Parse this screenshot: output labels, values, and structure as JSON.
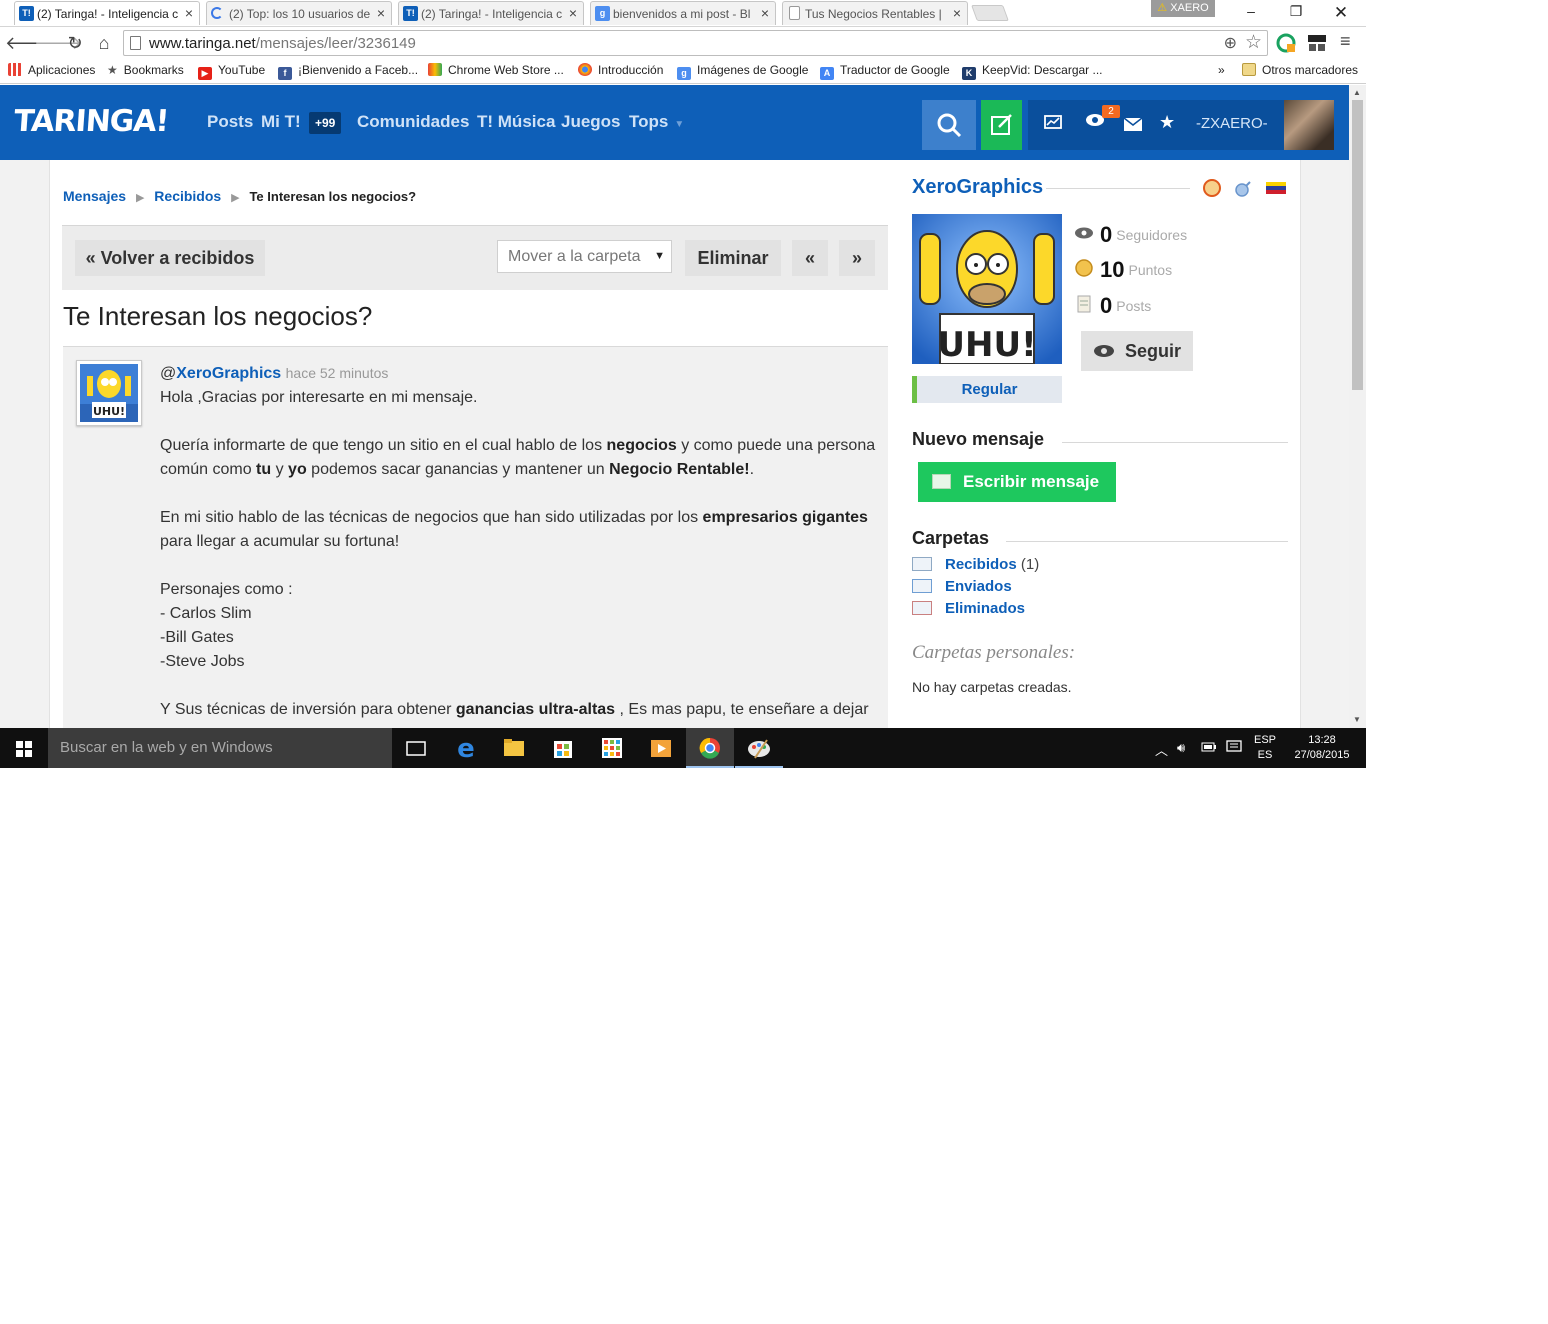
{
  "tabs": [
    {
      "title": "(2) Taringa! - Inteligencia c",
      "favicon": "T!",
      "active": true
    },
    {
      "title": "(2) Top: los 10 usuarios de",
      "favicon": "loading",
      "active": false
    },
    {
      "title": "(2) Taringa! - Inteligencia c",
      "favicon": "T!",
      "active": false
    },
    {
      "title": "bienvenidos a mi post - Bl",
      "favicon": "blogger",
      "active": false
    },
    {
      "title": "Tus Negocios Rentables |",
      "favicon": "page",
      "active": false
    }
  ],
  "chrome_user": "XAERO",
  "address_bar": {
    "url_host": "www.taringa.net",
    "url_path": "/mensajes/leer/3236149"
  },
  "bookmarks": {
    "apps": "Aplicaciones",
    "items": [
      "Bookmarks",
      "YouTube",
      "¡Bienvenido a Faceb...",
      "Chrome Web Store ...",
      "Introducción",
      "Imágenes de Google",
      "Traductor de Google",
      "KeepVid: Descargar ..."
    ],
    "overflow": "»",
    "other": "Otros marcadores"
  },
  "site_header": {
    "logo": "TARINGA!",
    "nav": {
      "posts": "Posts",
      "mi_t": "Mi T!",
      "badge": "+99",
      "comunidades": "Comunidades",
      "musica": "T! Música",
      "juegos": "Juegos",
      "tops": "Tops"
    },
    "notification_count": "2",
    "username": "-ZXAERO-"
  },
  "breadcrumb": {
    "root": "Mensajes",
    "folder": "Recibidos",
    "current": "Te Interesan los negocios?"
  },
  "actions": {
    "back": "« Volver a recibidos",
    "move_placeholder": "Mover a la carpeta",
    "delete": "Eliminar",
    "prev": "«",
    "next": "»"
  },
  "message": {
    "title": "Te Interesan los negocios?",
    "at": "@",
    "author": "XeroGraphics",
    "time": "hace 52 minutos",
    "greeting": "Hola ,Gracias por interesarte en mi mensaje.",
    "p1_a": "Quería informarte de que tengo un sitio en el cual hablo de los ",
    "p1_b": "negocios",
    "p1_c": " y como puede una persona común como ",
    "p1_d": "tu",
    "p1_e": " y ",
    "p1_f": "yo",
    "p1_g": " podemos sacar ganancias y mantener un ",
    "p1_h": "Negocio Rentable!",
    "p1_i": ".",
    "p2_a": "En mi sitio hablo de las técnicas de negocios que han sido utilizadas por los ",
    "p2_b": "empresarios gigantes",
    "p2_c": " para llegar a acumular su fortuna!",
    "p3_intro": "Personajes como :",
    "p3_l1": "- Carlos Slim",
    "p3_l2": "-Bill Gates",
    "p3_l3": "-Steve Jobs",
    "p4_a": "Y Sus técnicas de inversión para obtener ",
    "p4_b": "ganancias ultra-altas",
    "p4_c": " , Es mas papu, te enseñare a dejar"
  },
  "profile": {
    "name": "XeroGraphics",
    "image_caption": "UHU!",
    "followers": "0",
    "followers_label": "Seguidores",
    "points": "10",
    "points_label": "Puntos",
    "posts": "0",
    "posts_label": "Posts",
    "follow": "Seguir",
    "rank": "Regular"
  },
  "new_message": {
    "heading": "Nuevo mensaje",
    "button": "Escribir mensaje"
  },
  "folders": {
    "heading": "Carpetas",
    "items": [
      {
        "name": "Recibidos",
        "count": "(1)"
      },
      {
        "name": "Enviados",
        "count": ""
      },
      {
        "name": "Eliminados",
        "count": ""
      }
    ],
    "personal_heading": "Carpetas personales:",
    "personal_empty": "No hay carpetas creadas."
  },
  "taskbar": {
    "search_placeholder": "Buscar en la web y en Windows",
    "lang_top": "ESP",
    "lang_bottom": "ES",
    "time": "13:28",
    "date": "27/08/2015"
  },
  "colors": {
    "taringa_blue": "#0e5fb8",
    "write_green": "#1bb957",
    "rank_green": "#6cbf45"
  }
}
